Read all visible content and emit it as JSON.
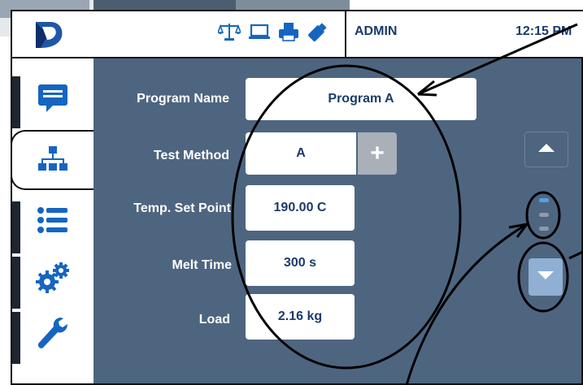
{
  "topbar": {
    "username": "ADMIN",
    "time": "12:15 PM",
    "status_icons": [
      "balance-icon",
      "laptop-icon",
      "printer-icon",
      "usb-drive-icon"
    ]
  },
  "nav": {
    "items": [
      {
        "name": "messages-icon",
        "active": false
      },
      {
        "name": "network-tree-icon",
        "active": true
      },
      {
        "name": "list-icon",
        "active": false
      },
      {
        "name": "gears-icon",
        "active": false
      },
      {
        "name": "wrench-icon",
        "active": false
      }
    ]
  },
  "form": {
    "program_name": {
      "label": "Program Name",
      "value": "Program A"
    },
    "test_method": {
      "label": "Test Method",
      "value": "A",
      "add_label": "+"
    },
    "temp_set_point": {
      "label": "Temp. Set Point",
      "value": "190.00 C"
    },
    "melt_time": {
      "label": "Melt Time",
      "value": "300 s"
    },
    "load": {
      "label": "Load",
      "value": "2.16 kg"
    }
  },
  "pager": {
    "pages": 3,
    "current": 1
  },
  "colors": {
    "panel": "#4e6580",
    "text_dark": "#1b3b6b",
    "accent": "#4ea4e6",
    "nav_icon": "#1565c0"
  }
}
